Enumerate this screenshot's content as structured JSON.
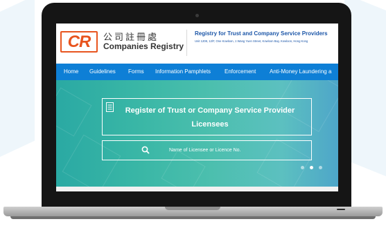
{
  "header": {
    "logo_text": "CR",
    "logo_chinese": "公司註冊處",
    "logo_english": "Companies Registry",
    "title": "Registry for Trust and Company Service Providers",
    "address": "Unit 1208, 12/F, One Kowloon, 1 Wang Yuen Street, Kowloon Bay, Kowloon, Hong Kong"
  },
  "nav": {
    "items": [
      {
        "label": "Home"
      },
      {
        "label": "Guidelines"
      },
      {
        "label": "Forms"
      },
      {
        "label": "Information Pamphlets"
      },
      {
        "label": "Enforcement"
      },
      {
        "label": "Anti-Money Laundering a"
      }
    ]
  },
  "hero": {
    "register_line1": "Register of Trust or Company Service Provider",
    "register_line2": "Licensees",
    "search_placeholder": "Name of Licensee or Licence No.",
    "carousel_dots": 3,
    "active_dot": 1
  },
  "icons": {
    "register": "document-icon",
    "search": "search-icon"
  },
  "colors": {
    "brand_orange": "#e8541e",
    "nav_blue": "#0e7fd6",
    "title_blue": "#1c56a8",
    "hero_teal": "#3ab7a6"
  }
}
